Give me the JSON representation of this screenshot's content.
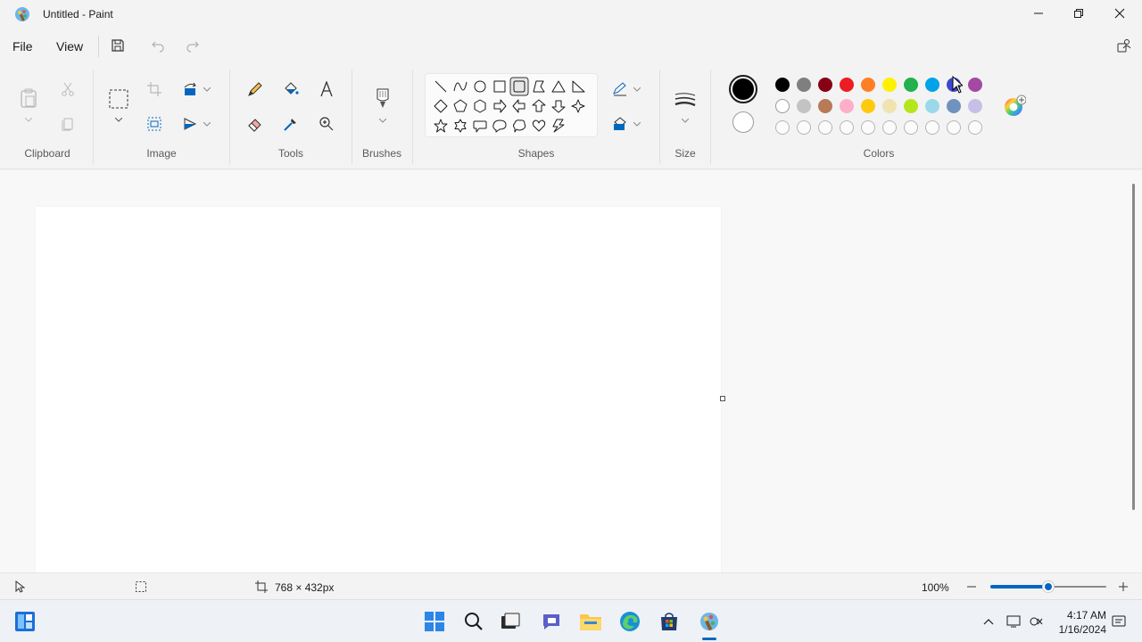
{
  "window": {
    "title": "Untitled - Paint",
    "minimize_icon": "minimize-icon",
    "restore_icon": "restore-icon",
    "close_icon": "close-icon"
  },
  "menu": {
    "file": "File",
    "view": "View",
    "save_icon": "save-icon",
    "undo_icon": "undo-icon",
    "redo_icon": "redo-icon",
    "account_icon": "account-icon"
  },
  "ribbon": {
    "groups": {
      "clipboard": "Clipboard",
      "image": "Image",
      "tools": "Tools",
      "brushes": "Brushes",
      "shapes": "Shapes",
      "size": "Size",
      "colors": "Colors"
    },
    "shapes": [
      "line",
      "curve",
      "oval",
      "rectangle",
      "rounded-rectangle",
      "polygon",
      "triangle",
      "right-triangle",
      "diamond",
      "pentagon",
      "hexagon",
      "right-arrow",
      "left-arrow",
      "up-arrow",
      "down-arrow",
      "four-point-star",
      "five-point-star",
      "six-point-star",
      "rounded-callout",
      "oval-callout",
      "cloud-callout",
      "heart",
      "lightning"
    ],
    "colors_row1": [
      "#000000",
      "#7f7f7f",
      "#880015",
      "#ed1c24",
      "#ff7f27",
      "#fff200",
      "#22b14c",
      "#00a2e8",
      "#3f48cc",
      "#a349a4"
    ],
    "colors_row2": [
      "#ffffff",
      "#c3c3c3",
      "#b97a57",
      "#ffaec9",
      "#ffc90e",
      "#efe4b0",
      "#b5e61d",
      "#99d9ea",
      "#7092be",
      "#c8bfe7"
    ],
    "primary_color": "#000000",
    "secondary_color": "#ffffff"
  },
  "status": {
    "canvas_size": "768 × 432px",
    "zoom": "100%",
    "zoom_level": 0.5
  },
  "taskbar": {
    "time": "4:17 AM",
    "date": "1/16/2024"
  }
}
